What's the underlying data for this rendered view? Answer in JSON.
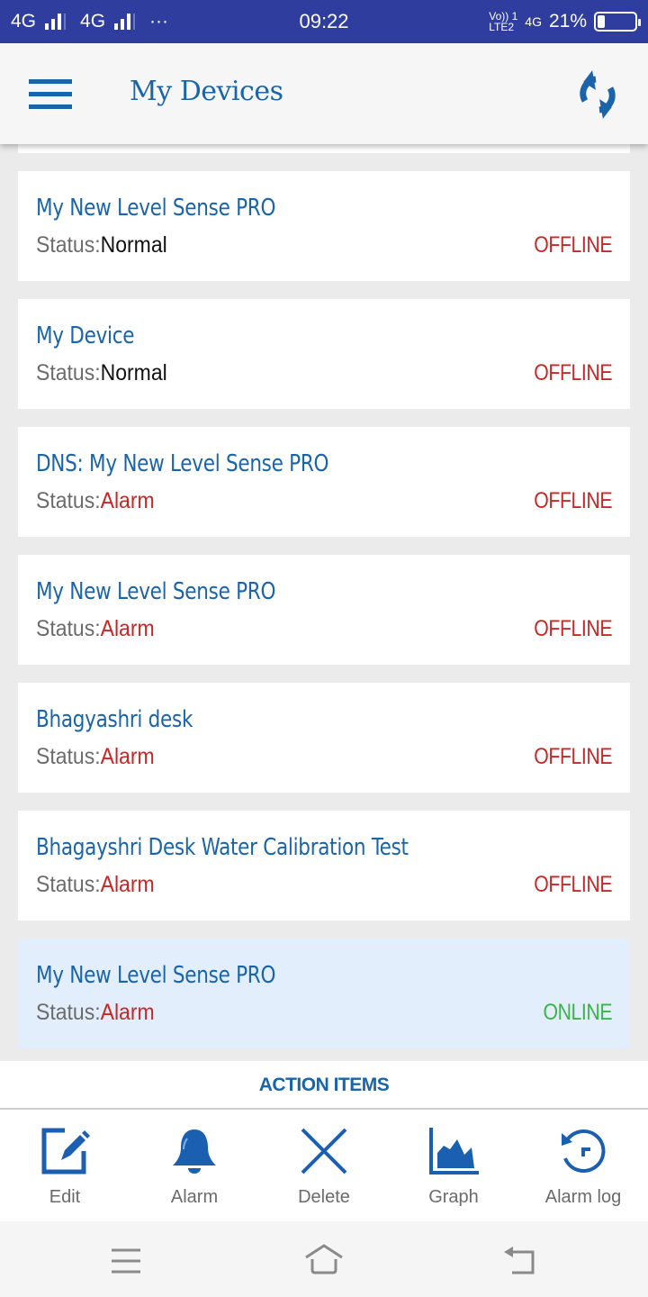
{
  "status_bar": {
    "sim1": "4G",
    "sim2": "4G",
    "more": "···",
    "time": "09:22",
    "volte_top": "Vo)) 1",
    "volte_bottom": "LTE2",
    "network": "4G",
    "battery_percent_label": "21%",
    "battery_level": 0.21
  },
  "app_bar": {
    "title": "My Devices",
    "menu_icon": "hamburger-menu-icon",
    "refresh_icon": "refresh-icon"
  },
  "devices": [
    {
      "name": "My New Level Sense PRO",
      "status_label": "Status:",
      "status": "Normal",
      "status_type": "normal",
      "connection": "OFFLINE",
      "connection_type": "offline"
    },
    {
      "name": "My Device",
      "status_label": "Status:",
      "status": "Normal",
      "status_type": "normal",
      "connection": "OFFLINE",
      "connection_type": "offline"
    },
    {
      "name": "DNS: My New Level Sense PRO",
      "status_label": "Status:",
      "status": "Alarm",
      "status_type": "alarm",
      "connection": "OFFLINE",
      "connection_type": "offline"
    },
    {
      "name": "My New Level Sense PRO",
      "status_label": "Status:",
      "status": "Alarm",
      "status_type": "alarm",
      "connection": "OFFLINE",
      "connection_type": "offline"
    },
    {
      "name": "Bhagyashri desk",
      "status_label": "Status:",
      "status": "Alarm",
      "status_type": "alarm",
      "connection": "OFFLINE",
      "connection_type": "offline"
    },
    {
      "name": "Bhagayshri Desk Water Calibration Test",
      "status_label": "Status:",
      "status": "Alarm",
      "status_type": "alarm",
      "connection": "OFFLINE",
      "connection_type": "offline"
    },
    {
      "name": "My New Level Sense PRO",
      "status_label": "Status:",
      "status": "Alarm",
      "status_type": "alarm",
      "connection": "ONLINE",
      "connection_type": "online",
      "selected": true
    }
  ],
  "action_items": {
    "header": "ACTION ITEMS",
    "items": [
      {
        "label": "Edit",
        "icon": "edit-icon"
      },
      {
        "label": "Alarm",
        "icon": "bell-icon"
      },
      {
        "label": "Delete",
        "icon": "close-icon"
      },
      {
        "label": "Graph",
        "icon": "area-chart-icon"
      },
      {
        "label": "Alarm log",
        "icon": "history-icon"
      }
    ]
  },
  "nav_bar": {
    "buttons": [
      "recents-icon",
      "home-icon",
      "back-icon"
    ]
  },
  "colors": {
    "primary": "#1a64a9",
    "status_bar": "#2f3e9e",
    "offline": "#c62828",
    "online": "#3cb34a",
    "selected_bg": "#e3eefc"
  }
}
